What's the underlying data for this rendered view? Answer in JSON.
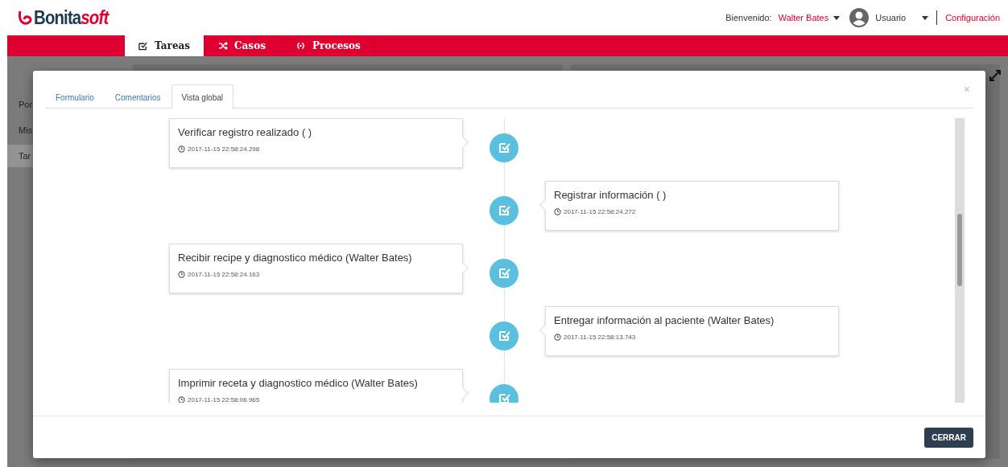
{
  "header": {
    "logo": {
      "part_1": "Bonita",
      "part_2": "soft"
    },
    "welcome_label": "Bienvenido:",
    "user_name": "Walter Bates",
    "profile": "Usuario",
    "settings_link": "Configuración"
  },
  "nav": [
    {
      "label": "Tareas",
      "kind": "check",
      "selected": true
    },
    {
      "label": "Casos",
      "kind": "shuffle",
      "selected": false
    },
    {
      "label": "Procesos",
      "kind": "cycle",
      "selected": false
    }
  ],
  "background_sidebar": [
    {
      "label": "Por",
      "selected": false
    },
    {
      "label": "Mis",
      "selected": false
    },
    {
      "label": "Tar",
      "selected": true
    }
  ],
  "modal": {
    "tabs": [
      {
        "label": "Formulario",
        "selected": false
      },
      {
        "label": "Comentarios",
        "selected": false
      },
      {
        "label": "Vista global",
        "selected": true
      }
    ],
    "close": "×",
    "timeline": [
      {
        "kind": "left",
        "title": "Verificar registro realizado ( )",
        "time": "2017-11-15 22:58:24.298"
      },
      {
        "kind": "right",
        "title": "Registrar información ( )",
        "time": "2017-11-15 22:58:24.272"
      },
      {
        "kind": "left",
        "title": "Recibir recipe y diagnostico médico (Walter Bates)",
        "time": "2017-11-15 22:58:24.163"
      },
      {
        "kind": "right",
        "title": "Entregar información al paciente (Walter Bates)",
        "time": "2017-11-15 22:58:13.743"
      },
      {
        "kind": "left",
        "title": "Imprimir receta y diagnostico médico (Walter Bates)",
        "time": "2017-11-15 22:58:06.965"
      }
    ],
    "close_button": "CERRAR"
  }
}
